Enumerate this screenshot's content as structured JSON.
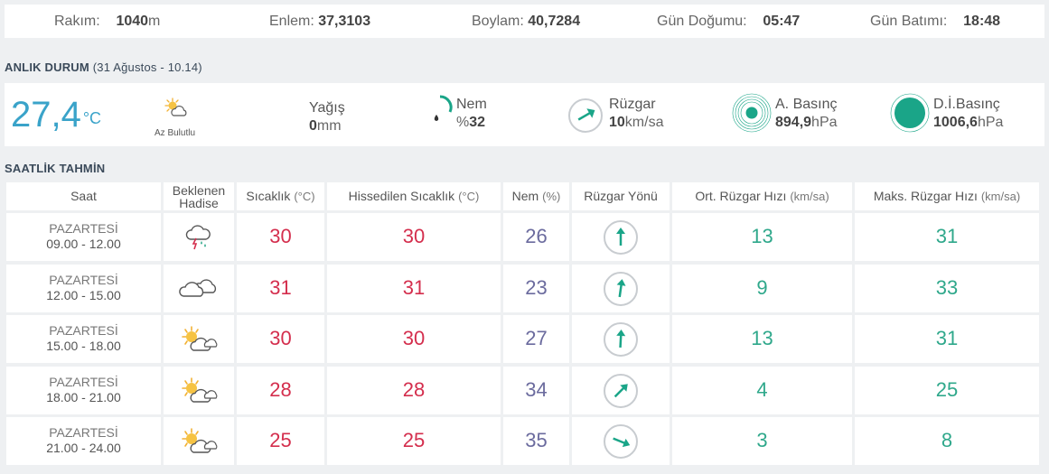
{
  "station": {
    "altitude_label": "Rakım:",
    "altitude_value": "1040",
    "altitude_unit": "m",
    "lat_label": "Enlem:",
    "lat_value": "37,3103",
    "lon_label": "Boylam:",
    "lon_value": "40,7284",
    "sunrise_label": "Gün Doğumu:",
    "sunrise_value": "05:47",
    "sunset_label": "Gün Batımı:",
    "sunset_value": "18:48"
  },
  "current": {
    "title": "ANLIK DURUM",
    "subtitle_open": "(",
    "subtitle_date": "31 Ağustos - 10.14",
    "subtitle_close": ")",
    "temperature": "27,4",
    "temperature_unit": "°C",
    "condition": "Az Bulutlu",
    "condition_icon": "partly-cloudy-icon",
    "precip_label": "Yağış",
    "precip_value": "0",
    "precip_unit": "mm",
    "humidity_label": "Nem",
    "humidity_prefix": "%",
    "humidity_value": "32",
    "wind_label": "Rüzgar",
    "wind_value": "10",
    "wind_unit": "km/sa",
    "pressure_label": "A. Basınç",
    "pressure_value": "894,9",
    "pressure_unit": "hPa",
    "sea_pressure_label": "D.İ.Basınç",
    "sea_pressure_value": "1006,6",
    "sea_pressure_unit": "hPa"
  },
  "forecast": {
    "title": "SAATLİK TAHMİN",
    "headers": {
      "time": "Saat",
      "event_line1": "Beklenen",
      "event_line2": "Hadise",
      "temp": "Sıcaklık",
      "temp_unit": "(°C)",
      "feels": "Hissedilen Sıcaklık",
      "feels_unit": "(°C)",
      "humidity": "Nem",
      "humidity_unit": "(%)",
      "wind_dir": "Rüzgar Yönü",
      "wind_avg": "Ort. Rüzgar Hızı",
      "wind_avg_unit": "(km/sa)",
      "wind_max": "Maks. Rüzgar Hızı",
      "wind_max_unit": "(km/sa)"
    },
    "rows": [
      {
        "day": "PAZARTESİ",
        "range": "09.00 - 12.00",
        "icon": "thunderstorm-rain-icon",
        "temp": "30",
        "feels": "30",
        "humidity": "26",
        "wind_dir_deg": 0,
        "wind_avg": "13",
        "wind_max": "31"
      },
      {
        "day": "PAZARTESİ",
        "range": "12.00 - 15.00",
        "icon": "cloudy-icon",
        "temp": "31",
        "feels": "31",
        "humidity": "23",
        "wind_dir_deg": 8,
        "wind_avg": "9",
        "wind_max": "33"
      },
      {
        "day": "PAZARTESİ",
        "range": "15.00 - 18.00",
        "icon": "partly-cloudy-icon",
        "temp": "30",
        "feels": "30",
        "humidity": "27",
        "wind_dir_deg": 3,
        "wind_avg": "13",
        "wind_max": "31"
      },
      {
        "day": "PAZARTESİ",
        "range": "18.00 - 21.00",
        "icon": "partly-cloudy-icon",
        "temp": "28",
        "feels": "28",
        "humidity": "34",
        "wind_dir_deg": 45,
        "wind_avg": "4",
        "wind_max": "25"
      },
      {
        "day": "PAZARTESİ",
        "range": "21.00 - 24.00",
        "icon": "partly-cloudy-icon",
        "temp": "25",
        "feels": "25",
        "humidity": "35",
        "wind_dir_deg": 112,
        "wind_avg": "3",
        "wind_max": "8"
      }
    ]
  },
  "colors": {
    "current_temp": "#3aa3c9",
    "temp_red": "#d42e4d",
    "humidity_purple": "#6b6b9e",
    "wind_green": "#2fa88b",
    "accent_teal": "#1aa588"
  }
}
